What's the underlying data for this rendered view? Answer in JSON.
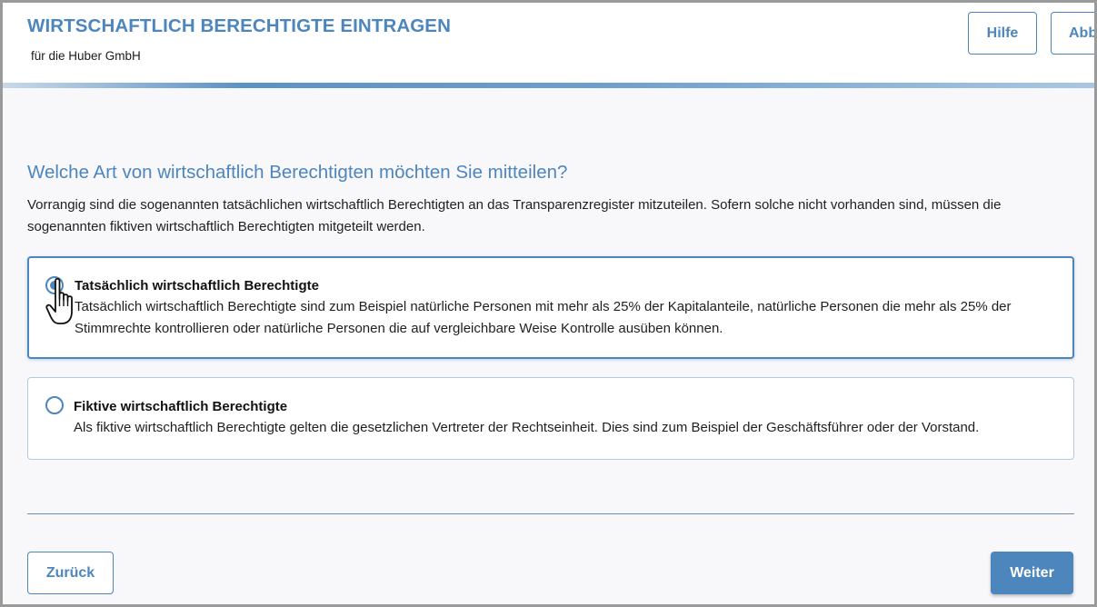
{
  "header": {
    "title": "WIRTSCHAFTLICH BERECHTIGTE EINTRAGEN",
    "subtitle": "für die Huber GmbH",
    "help_label": "Hilfe",
    "cancel_label": "Abbrechen"
  },
  "main": {
    "question": "Welche Art von wirtschaftlich Berechtigten möchten Sie mitteilen?",
    "intro": "Vorrangig sind die sogenannten tatsächlichen wirtschaftlich Berechtigten an das Transparenzregister mitzuteilen. Sofern solche nicht vorhanden sind, müssen die sogenannten fiktiven wirtschaftlich Berechtigten mitgeteilt werden.",
    "options": [
      {
        "title": "Tatsächlich wirtschaftlich Berechtigte",
        "description": "Tatsächlich wirtschaftlich Berechtigte sind zum Beispiel natürliche Personen mit mehr als 25% der Kapitalanteile, natürliche Personen die mehr als 25% der Stimmrechte kontrollieren oder natürliche Personen die auf vergleichbare Weise Kontrolle ausüben können.",
        "selected": true
      },
      {
        "title": "Fiktive wirtschaftlich Berechtigte",
        "description": "Als fiktive wirtschaftlich Berechtigte gelten die gesetzlichen Vertreter der Rechtseinheit. Dies sind zum Beispiel der Geschäftsführer oder der Vorstand.",
        "selected": false
      }
    ]
  },
  "footer": {
    "back_label": "Zurück",
    "next_label": "Weiter"
  },
  "colors": {
    "accent": "#4d86bd",
    "page_background": "#f8f7fa",
    "text": "#1f1f1f"
  },
  "icons": {
    "cursor": "hand-pointer-icon"
  }
}
